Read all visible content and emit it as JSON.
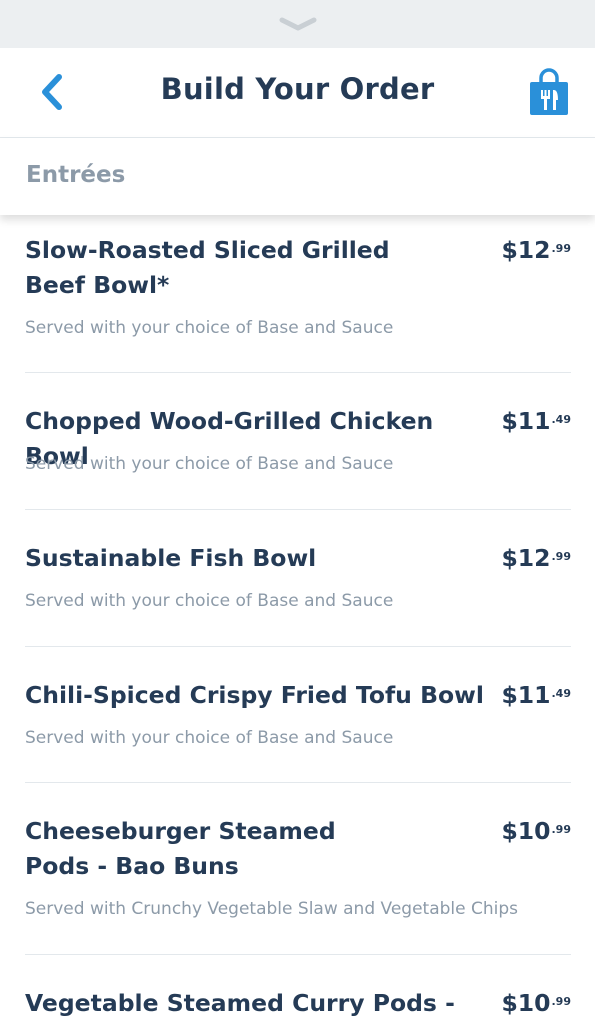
{
  "header": {
    "title": "Build Your Order",
    "back_icon": "chevron-left-icon",
    "bag_icon": "shopping-bag-icon",
    "accent_color": "#2a90d9",
    "grabber_icon": "chevron-down-icon"
  },
  "section": {
    "label": "Entrées"
  },
  "items": [
    {
      "name": "Slow-Roasted Sliced Grilled Beef Bowl*",
      "price_dollars": "$12",
      "price_cents": ".99",
      "description": "Served with your choice of Base and Sauce"
    },
    {
      "name": "Chopped Wood-Grilled Chicken Bowl",
      "price_dollars": "$11",
      "price_cents": ".49",
      "description": "Served with your choice of Base and Sauce"
    },
    {
      "name": "Sustainable Fish Bowl",
      "price_dollars": "$12",
      "price_cents": ".99",
      "description": "Served with your choice of Base and Sauce"
    },
    {
      "name": "Chili-Spiced Crispy Fried Tofu Bowl",
      "price_dollars": "$11",
      "price_cents": ".49",
      "description": "Served with your choice of Base and Sauce"
    },
    {
      "name": "Cheeseburger Steamed Pods - Bao Buns",
      "price_dollars": "$10",
      "price_cents": ".99",
      "description": "Served with Crunchy Vegetable Slaw and Vegetable Chips"
    },
    {
      "name": "Vegetable Steamed Curry Pods -",
      "price_dollars": "$10",
      "price_cents": ".99",
      "description": ""
    }
  ]
}
